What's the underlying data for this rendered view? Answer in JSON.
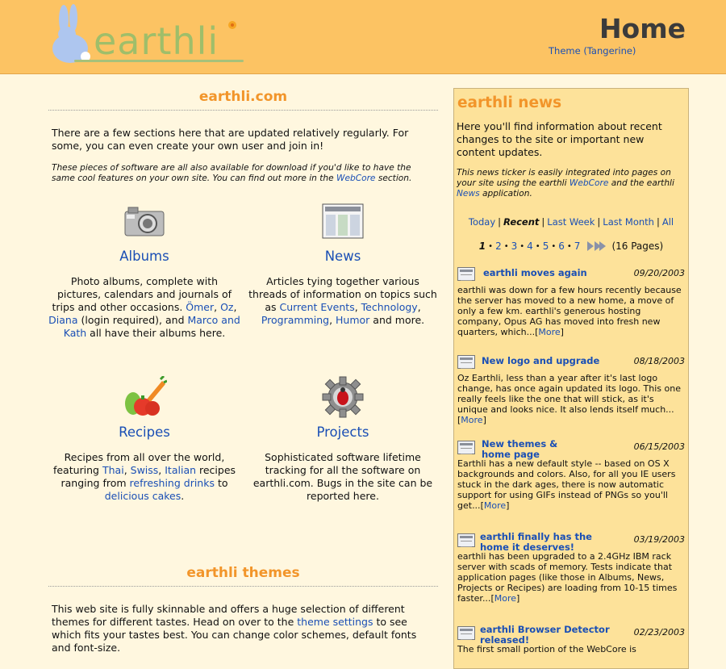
{
  "header": {
    "logo_text": "earthli",
    "page_title": "Home",
    "theme_link": "Theme (Tangerine)",
    "colors": {
      "header_bg": "#fcc363",
      "page_bg": "#fff7df",
      "sidebar_bg": "#fde29a",
      "accent": "#f2952a",
      "link": "#1a4fb5"
    }
  },
  "main": {
    "section_title": "earthli.com",
    "intro": "There are a few sections here that are updated relatively regularly. For some, you can even create your own user and join in!",
    "note_before": "These pieces of software are all also available for download if you'd like to have the same cool features on your own site. You can find out more in the ",
    "note_link": "WebCore",
    "note_after": " section.",
    "features": {
      "albums": {
        "title": "Albums",
        "icon": "camera-icon",
        "t1": "Photo albums, complete with pictures, calendars and journals of trips and other occasions. ",
        "l1": "Ömer",
        "t2": ", ",
        "l2": "Oz",
        "t3": ", ",
        "l3": "Diana",
        "t4": " (login required), and ",
        "l4": "Marco and Kath",
        "t5": " all have their albums here."
      },
      "news": {
        "title": "News",
        "icon": "newspaper-icon",
        "t1": "Articles tying together various threads of information on topics such as ",
        "l1": "Current Events",
        "t2": ", ",
        "l2": "Technology",
        "t3": ", ",
        "l3": "Programming",
        "t4": ", ",
        "l4": "Humor",
        "t5": " and more."
      },
      "recipes": {
        "title": "Recipes",
        "icon": "vegetables-icon",
        "t1": "Recipes from all over the world, featuring ",
        "l1": "Thai",
        "t2": ", ",
        "l2": "Swiss",
        "t3": ", ",
        "l3": "Italian",
        "t4": " recipes ranging from ",
        "l4": "refreshing drinks",
        "t5": " to ",
        "l5": "delicious cakes",
        "t6": "."
      },
      "projects": {
        "title": "Projects",
        "icon": "bug-gear-icon",
        "text": "Sophisticated software lifetime tracking for all the software on earthli.com. Bugs in the site can be reported here."
      }
    },
    "themes": {
      "title": "earthli themes",
      "t1": "This web site is fully skinnable and offers a huge selection of different themes for different tastes. Head on over to the ",
      "link": "theme settings",
      "t2": " to see which fits your tastes best. You can change color schemes, default fonts and font-size."
    }
  },
  "sidebar": {
    "title": "earthli news",
    "intro": "Here you'll find information about recent changes to the site or important new content updates.",
    "note_t1": "This news ticker is easily integrated into pages on your site using the earthli ",
    "note_l1": "WebCore",
    "note_t2": " and the earthli ",
    "note_l2": "News",
    "note_t3": " application.",
    "filters": [
      "Today",
      "Recent",
      "Last Week",
      "Last Month",
      "All"
    ],
    "active_filter": "Recent",
    "pager": {
      "pages": [
        "1",
        "2",
        "3",
        "4",
        "5",
        "6",
        "7"
      ],
      "current": "1",
      "count": "(16 Pages)"
    },
    "more_label": "More",
    "items": [
      {
        "title": "earthli moves again",
        "date": "09/20/2003",
        "body": "earthli was down for a few hours recently because the server has moved to a new home, a move of only a few km. earthli's generous hosting company, Opus AG has moved into fresh new quarters, which..."
      },
      {
        "title": "New logo and upgrade",
        "date": "08/18/2003",
        "body": "Oz Earthli, less than a year after it's last logo change, has once again updated its logo. This one really feels like the one that will stick, as it's unique and looks nice. It also lends itself much..."
      },
      {
        "title": "New themes & home page",
        "date": "06/15/2003",
        "body": "Earthli has a new default style -- based on OS X backgrounds and colors. Also, for all you IE users stuck in the dark ages, there is now automatic support for using GIFs instead of PNGs so you'll get..."
      },
      {
        "title": "earthli finally has the home it deserves!",
        "date": "03/19/2003",
        "body": "earthli has been upgraded to a 2.4GHz IBM rack server with scads of memory. Tests indicate that application pages (like those in Albums, News, Projects or Recipes) are loading from 10-15 times faster..."
      },
      {
        "title": "earthli Browser Detector released!",
        "date": "02/23/2003",
        "body": "The first small portion of the WebCore is"
      }
    ]
  }
}
